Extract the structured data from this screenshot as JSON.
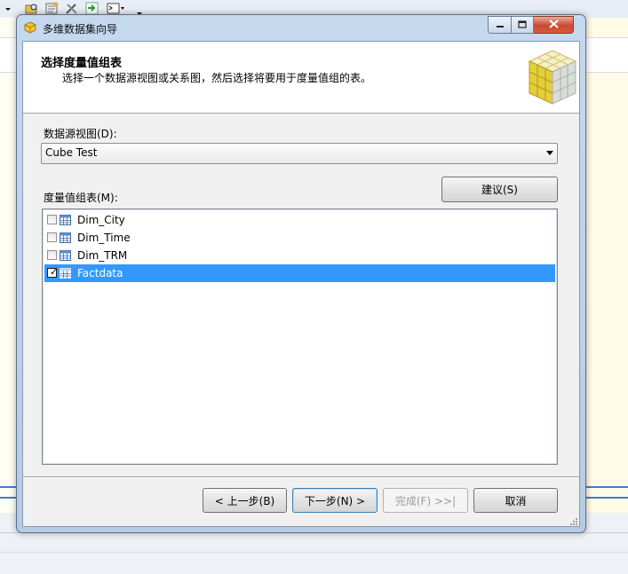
{
  "window": {
    "title": "多维数据集向导",
    "controls": {
      "minimize": "minimize",
      "maximize": "maximize",
      "close": "close"
    }
  },
  "header": {
    "title": "选择度量值组表",
    "description": "选择一个数据源视图或关系图，然后选择将要用于度量值组的表。"
  },
  "data_source_view": {
    "label": "数据源视图(D):",
    "selected": "Cube Test"
  },
  "measure_group_tables": {
    "label": "度量值组表(M):",
    "suggest_button": "建议(S)",
    "items": [
      {
        "label": "Dim_City",
        "checked": false,
        "selected": false
      },
      {
        "label": "Dim_Time",
        "checked": false,
        "selected": false
      },
      {
        "label": "Dim_TRM",
        "checked": false,
        "selected": false
      },
      {
        "label": "Factdata",
        "checked": true,
        "selected": true
      }
    ]
  },
  "buttons": {
    "back": "< 上一步(B)",
    "next": "下一步(N) >",
    "finish": "完成(F) >>|",
    "cancel": "取消"
  },
  "colors": {
    "selection": "#3399ff",
    "title_bar": "#c5d8ee",
    "close_button": "#c84a33"
  }
}
